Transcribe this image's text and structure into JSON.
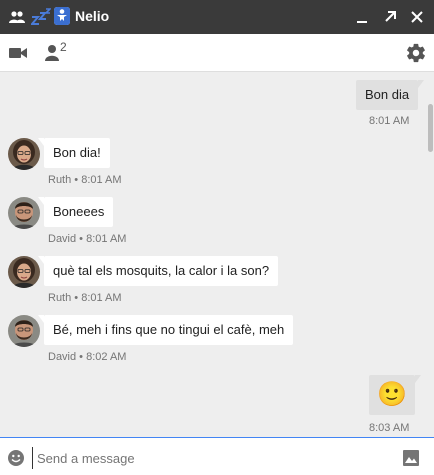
{
  "window": {
    "title": "Nelio"
  },
  "toolbar": {
    "participant_count": "2"
  },
  "messages": [
    {
      "direction": "out",
      "text": "Bon dia",
      "time": "8:01 AM"
    },
    {
      "direction": "in",
      "text": "Bon dia!",
      "meta": "Ruth • 8:01 AM",
      "avatar": "female-avatar"
    },
    {
      "direction": "in",
      "text": "Boneees",
      "meta": "David • 8:01 AM",
      "avatar": "male-avatar"
    },
    {
      "direction": "in",
      "text": "què tal els mosquits, la calor i la son?",
      "meta": "Ruth • 8:01 AM",
      "avatar": "female-avatar"
    },
    {
      "direction": "in",
      "text": "Bé, meh i fins que no tingui el cafè, meh",
      "meta": "David • 8:02 AM",
      "avatar": "male-avatar"
    },
    {
      "direction": "out",
      "emoji": "🙂",
      "time": "8:03 AM"
    }
  ],
  "input": {
    "placeholder": "Send a message",
    "value": ""
  },
  "icons": {
    "titlebar": [
      "group-icon",
      "sleep-icon",
      "hangouts-icon",
      "minimize-icon",
      "popout-icon",
      "close-icon"
    ],
    "toolbar": [
      "video-call-icon",
      "people-icon",
      "settings-gear-icon"
    ],
    "inputbar": [
      "emoji-icon",
      "image-icon"
    ]
  },
  "colors": {
    "titlebar": "#3a3a3a",
    "chat_background": "#eeeeee",
    "outgoing_bubble": "#e0e0e0",
    "incoming_bubble": "#ffffff",
    "input_accent": "#4285f4",
    "sleep_icon": "#4a7bd8"
  }
}
